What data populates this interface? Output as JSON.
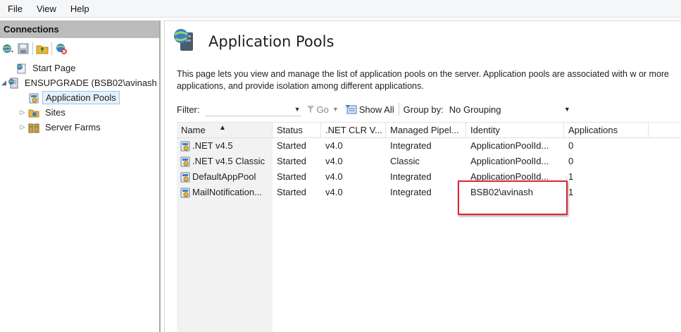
{
  "menu": {
    "items": [
      "File",
      "View",
      "Help"
    ]
  },
  "connections": {
    "header": "Connections",
    "toolbar_icons": [
      "connect-globe-icon",
      "save-icon",
      "up-folder-icon",
      "disconnect-icon"
    ],
    "tree": [
      {
        "label": "Start Page",
        "icon": "start-page-icon",
        "expander": ""
      },
      {
        "label": "ENSUPGRADE (BSB02\\avinash",
        "icon": "server-icon",
        "expander": "◢"
      },
      {
        "label": "Application Pools",
        "icon": "app-pool-icon",
        "expander": "",
        "selected": true
      },
      {
        "label": "Sites",
        "icon": "sites-icon",
        "expander": "▷"
      },
      {
        "label": "Server Farms",
        "icon": "server-farms-icon",
        "expander": "▷"
      }
    ]
  },
  "page": {
    "title": "Application Pools",
    "description": "This page lets you view and manage the list of application pools on the server. Application pools are associated with w or more applications, and provide isolation among different applications."
  },
  "filterbar": {
    "filter_label": "Filter:",
    "go_label": "Go",
    "show_all_label": "Show All",
    "group_by_label": "Group by:",
    "group_by_value": "No Grouping"
  },
  "grid": {
    "columns": [
      "Name",
      "Status",
      ".NET CLR V...",
      "Managed Pipel...",
      "Identity",
      "Applications"
    ],
    "rows": [
      {
        "name": ".NET v4.5",
        "status": "Started",
        "clr": "v4.0",
        "pipeline": "Integrated",
        "identity": "ApplicationPoolId...",
        "apps": "0"
      },
      {
        "name": ".NET v4.5 Classic",
        "status": "Started",
        "clr": "v4.0",
        "pipeline": "Classic",
        "identity": "ApplicationPoolId...",
        "apps": "0"
      },
      {
        "name": "DefaultAppPool",
        "status": "Started",
        "clr": "v4.0",
        "pipeline": "Integrated",
        "identity": "ApplicationPoolId...",
        "apps": "1"
      },
      {
        "name": "MailNotification...",
        "status": "Started",
        "clr": "v4.0",
        "pipeline": "Integrated",
        "identity": "BSB02\\avinash",
        "apps": "1"
      }
    ]
  },
  "colors": {
    "highlight": "#e0262d",
    "header_bg": "#bcbcbc",
    "selection": "#e5f1fb"
  }
}
